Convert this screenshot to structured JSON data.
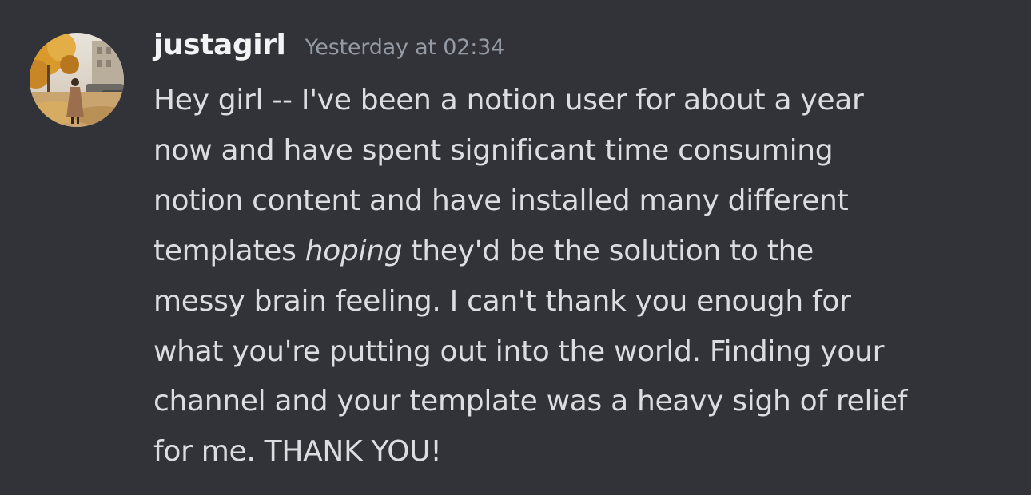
{
  "message": {
    "author": "justagirl",
    "timestamp": "Yesterday at 02:34",
    "avatar_icon": "user-avatar-photo",
    "lines": [
      "Hey girl -- I've been a notion user for about a year",
      "now and have spent significant time consuming",
      "notion content and have installed many different"
    ],
    "line4_before": "templates ",
    "line4_emphasis": "hoping",
    "line4_after": " they'd be the solution to the",
    "lines_rest": [
      "messy brain feeling. I can't thank you enough for",
      "what you're putting out into the world. Finding your",
      "channel and your template was a heavy sigh of relief",
      "for me. THANK YOU!"
    ]
  },
  "colors": {
    "background": "#313338",
    "username": "#f2f3f5",
    "timestamp": "#949ba4",
    "text": "#dbdee1"
  }
}
